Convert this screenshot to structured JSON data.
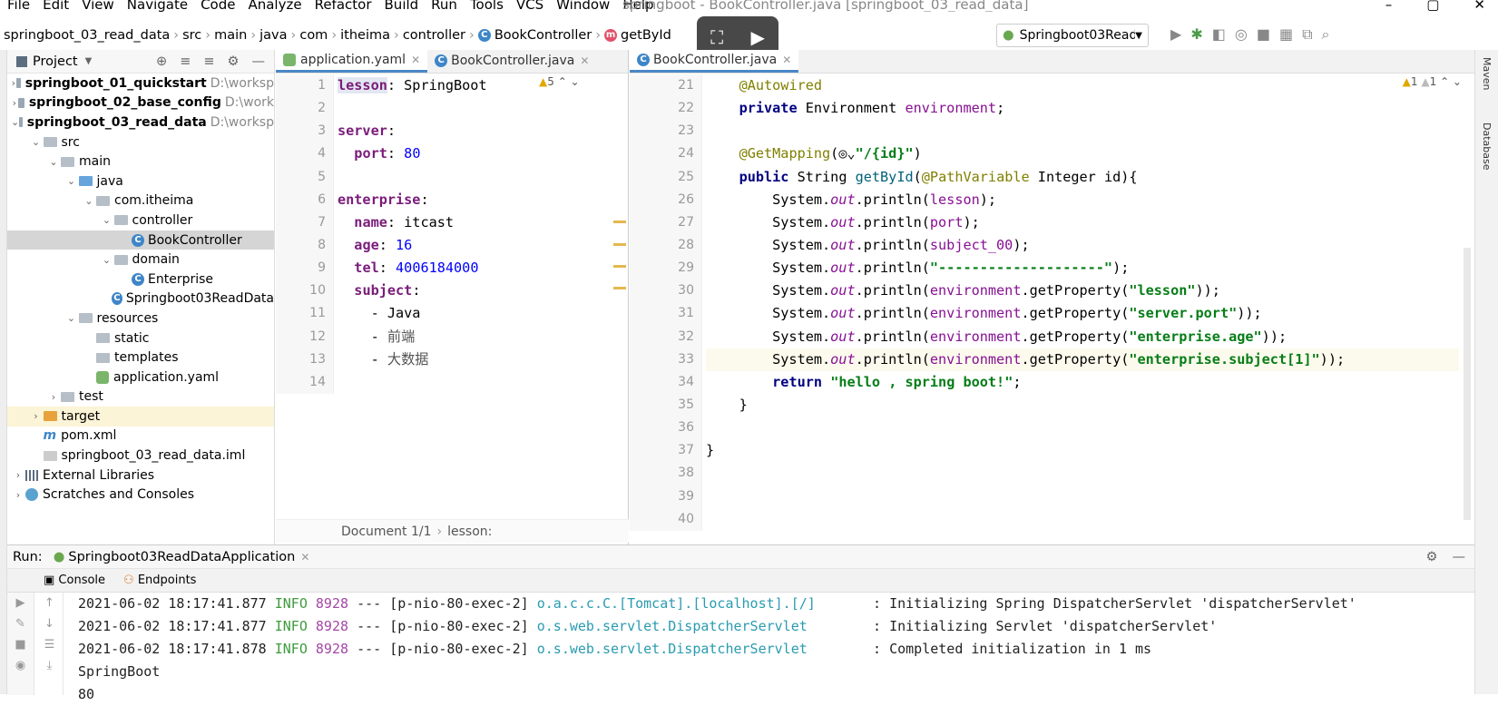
{
  "menubar": {
    "items": [
      "File",
      "Edit",
      "View",
      "Navigate",
      "Code",
      "Analyze",
      "Refactor",
      "Build",
      "Run",
      "Tools",
      "VCS",
      "Window",
      "Help"
    ],
    "window_title": "springboot - BookController.java [springboot_03_read_data]"
  },
  "breadcrumb": [
    "springboot_03_read_data",
    "src",
    "main",
    "java",
    "com",
    "itheima",
    "controller",
    "BookController",
    "getById"
  ],
  "run_config": "Springboot03ReadDataApplication",
  "project": {
    "title": "Project",
    "tree": [
      {
        "indent": 0,
        "arrow": "›",
        "icon": "proj",
        "label": "springboot_01_quickstart",
        "path": "D:\\worksp",
        "bold": true
      },
      {
        "indent": 0,
        "arrow": "›",
        "icon": "proj",
        "label": "springboot_02_base_config",
        "path": "D:\\work",
        "bold": true
      },
      {
        "indent": 0,
        "arrow": "⌄",
        "icon": "proj",
        "label": "springboot_03_read_data",
        "path": "D:\\worksp",
        "bold": true
      },
      {
        "indent": 1,
        "arrow": "⌄",
        "icon": "folder",
        "label": "src"
      },
      {
        "indent": 2,
        "arrow": "⌄",
        "icon": "folder",
        "label": "main"
      },
      {
        "indent": 3,
        "arrow": "⌄",
        "icon": "blue",
        "label": "java"
      },
      {
        "indent": 4,
        "arrow": "⌄",
        "icon": "folder",
        "label": "com.itheima"
      },
      {
        "indent": 5,
        "arrow": "⌄",
        "icon": "folder",
        "label": "controller"
      },
      {
        "indent": 6,
        "arrow": "",
        "icon": "class",
        "label": "BookController",
        "selected": true
      },
      {
        "indent": 5,
        "arrow": "⌄",
        "icon": "folder",
        "label": "domain"
      },
      {
        "indent": 6,
        "arrow": "",
        "icon": "class",
        "label": "Enterprise"
      },
      {
        "indent": 5,
        "arrow": "",
        "icon": "class",
        "label": "Springboot03ReadData"
      },
      {
        "indent": 3,
        "arrow": "⌄",
        "icon": "folder",
        "label": "resources"
      },
      {
        "indent": 4,
        "arrow": "",
        "icon": "folder",
        "label": "static"
      },
      {
        "indent": 4,
        "arrow": "",
        "icon": "folder",
        "label": "templates"
      },
      {
        "indent": 4,
        "arrow": "",
        "icon": "yaml",
        "label": "application.yaml"
      },
      {
        "indent": 2,
        "arrow": "›",
        "icon": "folder",
        "label": "test"
      },
      {
        "indent": 1,
        "arrow": "›",
        "icon": "orange",
        "label": "target",
        "highlight": true
      },
      {
        "indent": 1,
        "arrow": "",
        "icon": "xml",
        "label": "pom.xml"
      },
      {
        "indent": 1,
        "arrow": "",
        "icon": "iml",
        "label": "springboot_03_read_data.iml"
      },
      {
        "indent": 0,
        "arrow": "›",
        "icon": "lib",
        "label": "External Libraries"
      },
      {
        "indent": 0,
        "arrow": "›",
        "icon": "scratch",
        "label": "Scratches and Consoles"
      }
    ]
  },
  "yaml_editor": {
    "tabs": [
      {
        "label": "application.yaml",
        "active": true
      },
      {
        "label": "BookController.java",
        "active": false
      }
    ],
    "warnings": "5",
    "line_numbers": [
      "1",
      "2",
      "3",
      "4",
      "5",
      "6",
      "7",
      "8",
      "9",
      "10",
      "11",
      "12",
      "13",
      "14"
    ],
    "footer": "Document 1/1",
    "footer_path": "lesson:",
    "lines": [
      [
        {
          "t": "lesson",
          "c": "k-key"
        },
        {
          "t": ": SpringBoot"
        }
      ],
      [],
      [
        {
          "t": "server",
          "c": "k-key"
        },
        {
          "t": ":"
        }
      ],
      [
        {
          "t": "  "
        },
        {
          "t": "port",
          "c": "k-key"
        },
        {
          "t": ": "
        },
        {
          "t": "80",
          "c": "k-num"
        }
      ],
      [],
      [
        {
          "t": "enterprise",
          "c": "k-key"
        },
        {
          "t": ":"
        }
      ],
      [
        {
          "t": "  "
        },
        {
          "t": "name",
          "c": "k-key"
        },
        {
          "t": ": itcast"
        }
      ],
      [
        {
          "t": "  "
        },
        {
          "t": "age",
          "c": "k-key"
        },
        {
          "t": ": "
        },
        {
          "t": "16",
          "c": "k-num"
        }
      ],
      [
        {
          "t": "  "
        },
        {
          "t": "tel",
          "c": "k-key"
        },
        {
          "t": ": "
        },
        {
          "t": "4006184000",
          "c": "k-num"
        }
      ],
      [
        {
          "t": "  "
        },
        {
          "t": "subject",
          "c": "k-key"
        },
        {
          "t": ":"
        }
      ],
      [
        {
          "t": "    - Java"
        }
      ],
      [
        {
          "t": "    - "
        },
        {
          "t": "前端",
          "c": "k-cyr"
        }
      ],
      [
        {
          "t": "    - "
        },
        {
          "t": "大数据",
          "c": "k-cyr"
        }
      ],
      []
    ]
  },
  "java_editor": {
    "tabs": [
      {
        "label": "BookController.java",
        "active": true
      }
    ],
    "warnings_a": "1",
    "warnings_b": "1",
    "line_numbers": [
      "21",
      "22",
      "23",
      "24",
      "25",
      "26",
      "27",
      "28",
      "29",
      "30",
      "31",
      "32",
      "33",
      "34",
      "35",
      "36",
      "37",
      "38",
      "39",
      "40"
    ],
    "lines": [
      [
        {
          "t": "    "
        },
        {
          "t": "@Autowired",
          "c": "k-ann"
        }
      ],
      [
        {
          "t": "    "
        },
        {
          "t": "private",
          "c": "k-kw"
        },
        {
          "t": " Environment "
        },
        {
          "t": "environment",
          "c": "k-field"
        },
        {
          "t": ";"
        }
      ],
      [],
      [
        {
          "t": "    "
        },
        {
          "t": "@GetMapping",
          "c": "k-ann"
        },
        {
          "t": "(◎⌄"
        },
        {
          "t": "\"/{id}\"",
          "c": "k-str"
        },
        {
          "t": ")"
        }
      ],
      [
        {
          "t": "    "
        },
        {
          "t": "public",
          "c": "k-kw"
        },
        {
          "t": " String "
        },
        {
          "t": "getById",
          "c": "k-meth"
        },
        {
          "t": "("
        },
        {
          "t": "@PathVariable",
          "c": "k-ann"
        },
        {
          "t": " Integer id){"
        }
      ],
      [
        {
          "t": "        System."
        },
        {
          "t": "out",
          "c": "k-ital"
        },
        {
          "t": ".println("
        },
        {
          "t": "lesson",
          "c": "k-field"
        },
        {
          "t": ");"
        }
      ],
      [
        {
          "t": "        System."
        },
        {
          "t": "out",
          "c": "k-ital"
        },
        {
          "t": ".println("
        },
        {
          "t": "port",
          "c": "k-field"
        },
        {
          "t": ");"
        }
      ],
      [
        {
          "t": "        System."
        },
        {
          "t": "out",
          "c": "k-ital"
        },
        {
          "t": ".println("
        },
        {
          "t": "subject_00",
          "c": "k-field"
        },
        {
          "t": ");"
        }
      ],
      [
        {
          "t": "        System."
        },
        {
          "t": "out",
          "c": "k-ital"
        },
        {
          "t": ".println("
        },
        {
          "t": "\"--------------------\"",
          "c": "k-str"
        },
        {
          "t": ");"
        }
      ],
      [
        {
          "t": "        System."
        },
        {
          "t": "out",
          "c": "k-ital"
        },
        {
          "t": ".println("
        },
        {
          "t": "environment",
          "c": "k-field"
        },
        {
          "t": ".getProperty("
        },
        {
          "t": "\"lesson\"",
          "c": "k-str"
        },
        {
          "t": "));"
        }
      ],
      [
        {
          "t": "        System."
        },
        {
          "t": "out",
          "c": "k-ital"
        },
        {
          "t": ".println("
        },
        {
          "t": "environment",
          "c": "k-field"
        },
        {
          "t": ".getProperty("
        },
        {
          "t": "\"server.port\"",
          "c": "k-str"
        },
        {
          "t": "));"
        }
      ],
      [
        {
          "t": "        System."
        },
        {
          "t": "out",
          "c": "k-ital"
        },
        {
          "t": ".println("
        },
        {
          "t": "environment",
          "c": "k-field"
        },
        {
          "t": ".getProperty("
        },
        {
          "t": "\"enterprise.age\"",
          "c": "k-str"
        },
        {
          "t": "));"
        }
      ],
      [
        {
          "t": "        System."
        },
        {
          "t": "out",
          "c": "k-ital"
        },
        {
          "t": ".println("
        },
        {
          "t": "environment",
          "c": "k-field"
        },
        {
          "t": ".getProperty("
        },
        {
          "t": "\"enterprise.subject[1]\"",
          "c": "k-str"
        },
        {
          "t": "));"
        }
      ],
      [
        {
          "t": "        "
        },
        {
          "t": "return",
          "c": "k-kw"
        },
        {
          "t": " "
        },
        {
          "t": "\"hello , spring boot!\"",
          "c": "k-str"
        },
        {
          "t": ";"
        }
      ],
      [
        {
          "t": "    }"
        }
      ],
      [],
      [
        {
          "t": "}"
        }
      ],
      [],
      [],
      []
    ]
  },
  "run_panel": {
    "label": "Run:",
    "config": "Springboot03ReadDataApplication",
    "tabs": [
      "Console",
      "Endpoints"
    ],
    "log": [
      {
        "ts": "2021-06-02 18:17:41.877",
        "level": "INFO",
        "pid": "8928",
        "sep": "---",
        "thread": "[p-nio-80-exec-2]",
        "logger": "o.a.c.c.C.[Tomcat].[localhost].[/]      ",
        "msg": ": Initializing Spring DispatcherServlet 'dispatcherServlet'"
      },
      {
        "ts": "2021-06-02 18:17:41.877",
        "level": "INFO",
        "pid": "8928",
        "sep": "---",
        "thread": "[p-nio-80-exec-2]",
        "logger": "o.s.web.servlet.DispatcherServlet       ",
        "msg": ": Initializing Servlet 'dispatcherServlet'"
      },
      {
        "ts": "2021-06-02 18:17:41.878",
        "level": "INFO",
        "pid": "8928",
        "sep": "---",
        "thread": "[p-nio-80-exec-2]",
        "logger": "o.s.web.servlet.DispatcherServlet       ",
        "msg": ": Completed initialization in 1 ms"
      }
    ],
    "output": [
      "SpringBoot",
      "80"
    ]
  },
  "right_strip": [
    "Maven",
    "Database"
  ]
}
